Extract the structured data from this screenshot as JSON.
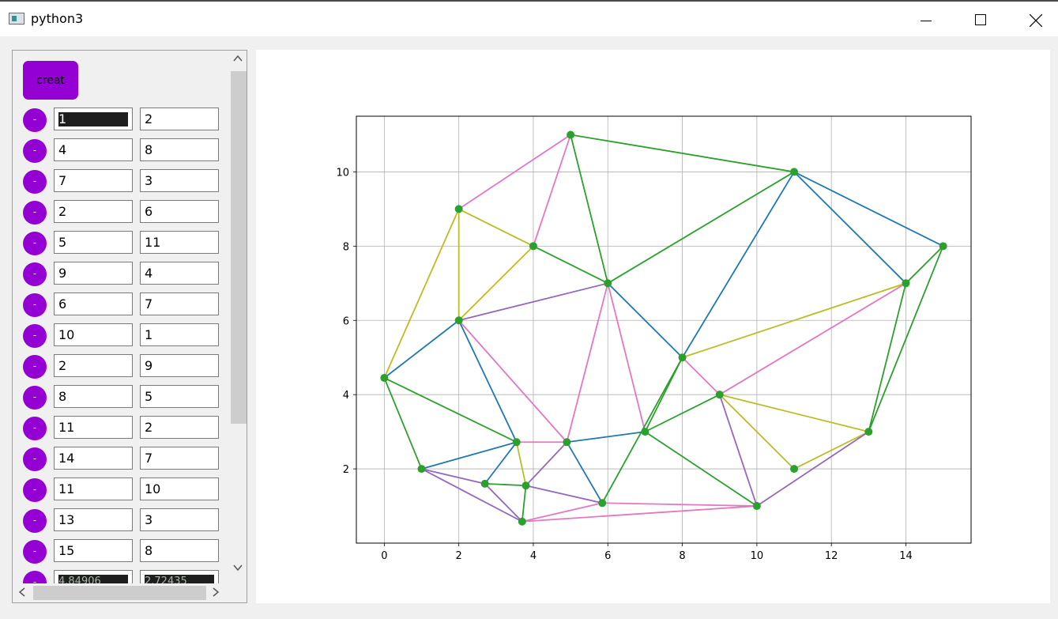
{
  "window": {
    "title": "python3"
  },
  "panel": {
    "create_label": "creat",
    "remove_label": "-",
    "rows": [
      {
        "a": "1",
        "b": "2"
      },
      {
        "a": "4",
        "b": "8"
      },
      {
        "a": "7",
        "b": "3"
      },
      {
        "a": "2",
        "b": "6"
      },
      {
        "a": "5",
        "b": "11"
      },
      {
        "a": "9",
        "b": "4"
      },
      {
        "a": "6",
        "b": "7"
      },
      {
        "a": "10",
        "b": "1"
      },
      {
        "a": "2",
        "b": "9"
      },
      {
        "a": "8",
        "b": "5"
      },
      {
        "a": "11",
        "b": "2"
      },
      {
        "a": "14",
        "b": "7"
      },
      {
        "a": "11",
        "b": "10"
      },
      {
        "a": "13",
        "b": "3"
      },
      {
        "a": "15",
        "b": "8"
      },
      {
        "a": "4.84906",
        "b": "2.72435"
      }
    ]
  },
  "chart_data": {
    "type": "scatter",
    "xlim": [
      -0.75,
      15.75
    ],
    "ylim": [
      0,
      11.5
    ],
    "xticks": [
      0,
      2,
      4,
      6,
      8,
      10,
      12,
      14
    ],
    "yticks": [
      2,
      4,
      6,
      8,
      10
    ],
    "grid": true,
    "point_color": "#2ca02c",
    "points": [
      [
        0,
        4.45
      ],
      [
        1,
        2
      ],
      [
        2,
        9
      ],
      [
        2,
        6
      ],
      [
        2.7,
        1.6
      ],
      [
        3.55,
        2.72
      ],
      [
        3.8,
        1.55
      ],
      [
        3.7,
        0.58
      ],
      [
        4,
        8
      ],
      [
        4.9,
        2.72
      ],
      [
        5,
        11
      ],
      [
        5.85,
        1.08
      ],
      [
        6,
        7
      ],
      [
        7,
        3
      ],
      [
        8,
        5
      ],
      [
        9,
        4
      ],
      [
        10,
        1
      ],
      [
        11,
        2
      ],
      [
        11,
        10
      ],
      [
        13,
        3
      ],
      [
        14,
        7
      ],
      [
        15,
        8
      ]
    ],
    "edges": [
      {
        "p": [
          [
            2,
            9
          ],
          [
            5,
            11
          ]
        ],
        "c": "#e377c2"
      },
      {
        "p": [
          [
            5,
            11
          ],
          [
            11,
            10
          ]
        ],
        "c": "#2ca02c"
      },
      {
        "p": [
          [
            11,
            10
          ],
          [
            15,
            8
          ]
        ],
        "c": "#1f77b4"
      },
      {
        "p": [
          [
            11,
            10
          ],
          [
            14,
            7
          ]
        ],
        "c": "#1f77b4"
      },
      {
        "p": [
          [
            15,
            8
          ],
          [
            14,
            7
          ]
        ],
        "c": "#2ca02c"
      },
      {
        "p": [
          [
            15,
            8
          ],
          [
            13,
            3
          ]
        ],
        "c": "#2ca02c"
      },
      {
        "p": [
          [
            14,
            7
          ],
          [
            13,
            3
          ]
        ],
        "c": "#2ca02c"
      },
      {
        "p": [
          [
            14,
            7
          ],
          [
            8,
            5
          ]
        ],
        "c": "#bcbd22"
      },
      {
        "p": [
          [
            14,
            7
          ],
          [
            9,
            4
          ]
        ],
        "c": "#e377c2"
      },
      {
        "p": [
          [
            11,
            10
          ],
          [
            6,
            7
          ]
        ],
        "c": "#2ca02c"
      },
      {
        "p": [
          [
            11,
            10
          ],
          [
            8,
            5
          ]
        ],
        "c": "#1f77b4"
      },
      {
        "p": [
          [
            5,
            11
          ],
          [
            4,
            8
          ]
        ],
        "c": "#e377c2"
      },
      {
        "p": [
          [
            5,
            11
          ],
          [
            6,
            7
          ]
        ],
        "c": "#2ca02c"
      },
      {
        "p": [
          [
            2,
            9
          ],
          [
            4,
            8
          ]
        ],
        "c": "#bcbd22"
      },
      {
        "p": [
          [
            2,
            9
          ],
          [
            2,
            6
          ]
        ],
        "c": "#bcbd22"
      },
      {
        "p": [
          [
            2,
            9
          ],
          [
            0,
            4.45
          ]
        ],
        "c": "#bcbd22"
      },
      {
        "p": [
          [
            4,
            8
          ],
          [
            2,
            6
          ]
        ],
        "c": "#bcbd22"
      },
      {
        "p": [
          [
            4,
            8
          ],
          [
            6,
            7
          ]
        ],
        "c": "#2ca02c"
      },
      {
        "p": [
          [
            2,
            6
          ],
          [
            6,
            7
          ]
        ],
        "c": "#9467bd"
      },
      {
        "p": [
          [
            0,
            4.45
          ],
          [
            2,
            6
          ]
        ],
        "c": "#1f77b4"
      },
      {
        "p": [
          [
            0,
            4.45
          ],
          [
            3.55,
            2.72
          ]
        ],
        "c": "#2ca02c"
      },
      {
        "p": [
          [
            0,
            4.45
          ],
          [
            1,
            2
          ]
        ],
        "c": "#2ca02c"
      },
      {
        "p": [
          [
            2,
            6
          ],
          [
            3.55,
            2.72
          ]
        ],
        "c": "#1f77b4"
      },
      {
        "p": [
          [
            2,
            6
          ],
          [
            4.9,
            2.72
          ]
        ],
        "c": "#e377c2"
      },
      {
        "p": [
          [
            6,
            7
          ],
          [
            4.9,
            2.72
          ]
        ],
        "c": "#e377c2"
      },
      {
        "p": [
          [
            6,
            7
          ],
          [
            7,
            3
          ]
        ],
        "c": "#e377c2"
      },
      {
        "p": [
          [
            6,
            7
          ],
          [
            8,
            5
          ]
        ],
        "c": "#1f77b4"
      },
      {
        "p": [
          [
            8,
            5
          ],
          [
            9,
            4
          ]
        ],
        "c": "#e377c2"
      },
      {
        "p": [
          [
            8,
            5
          ],
          [
            7,
            3
          ]
        ],
        "c": "#2ca02c"
      },
      {
        "p": [
          [
            8,
            5
          ],
          [
            5.85,
            1.08
          ]
        ],
        "c": "#2ca02c"
      },
      {
        "p": [
          [
            9,
            4
          ],
          [
            7,
            3
          ]
        ],
        "c": "#2ca02c"
      },
      {
        "p": [
          [
            9,
            4
          ],
          [
            13,
            3
          ]
        ],
        "c": "#bcbd22"
      },
      {
        "p": [
          [
            9,
            4
          ],
          [
            11,
            2
          ]
        ],
        "c": "#bcbd22"
      },
      {
        "p": [
          [
            9,
            4
          ],
          [
            10,
            1
          ]
        ],
        "c": "#9467bd"
      },
      {
        "p": [
          [
            13,
            3
          ],
          [
            11,
            2
          ]
        ],
        "c": "#bcbd22"
      },
      {
        "p": [
          [
            13,
            3
          ],
          [
            10,
            1
          ]
        ],
        "c": "#9467bd"
      },
      {
        "p": [
          [
            7,
            3
          ],
          [
            10,
            1
          ]
        ],
        "c": "#2ca02c"
      },
      {
        "p": [
          [
            7,
            3
          ],
          [
            4.9,
            2.72
          ]
        ],
        "c": "#1f77b4"
      },
      {
        "p": [
          [
            4.9,
            2.72
          ],
          [
            3.55,
            2.72
          ]
        ],
        "c": "#e377c2"
      },
      {
        "p": [
          [
            4.9,
            2.72
          ],
          [
            5.85,
            1.08
          ]
        ],
        "c": "#1f77b4"
      },
      {
        "p": [
          [
            4.9,
            2.72
          ],
          [
            3.8,
            1.55
          ]
        ],
        "c": "#9467bd"
      },
      {
        "p": [
          [
            3.55,
            2.72
          ],
          [
            1,
            2
          ]
        ],
        "c": "#1f77b4"
      },
      {
        "p": [
          [
            3.55,
            2.72
          ],
          [
            2.7,
            1.6
          ]
        ],
        "c": "#1f77b4"
      },
      {
        "p": [
          [
            3.55,
            2.72
          ],
          [
            3.8,
            1.55
          ]
        ],
        "c": "#bcbd22"
      },
      {
        "p": [
          [
            1,
            2
          ],
          [
            2.7,
            1.6
          ]
        ],
        "c": "#9467bd"
      },
      {
        "p": [
          [
            1,
            2
          ],
          [
            3.7,
            0.58
          ]
        ],
        "c": "#9467bd"
      },
      {
        "p": [
          [
            2.7,
            1.6
          ],
          [
            3.8,
            1.55
          ]
        ],
        "c": "#2ca02c"
      },
      {
        "p": [
          [
            2.7,
            1.6
          ],
          [
            3.7,
            0.58
          ]
        ],
        "c": "#9467bd"
      },
      {
        "p": [
          [
            3.8,
            1.55
          ],
          [
            3.7,
            0.58
          ]
        ],
        "c": "#2ca02c"
      },
      {
        "p": [
          [
            3.8,
            1.55
          ],
          [
            5.85,
            1.08
          ]
        ],
        "c": "#9467bd"
      },
      {
        "p": [
          [
            3.7,
            0.58
          ],
          [
            5.85,
            1.08
          ]
        ],
        "c": "#e377c2"
      },
      {
        "p": [
          [
            3.7,
            0.58
          ],
          [
            10,
            1
          ]
        ],
        "c": "#e377c2"
      },
      {
        "p": [
          [
            5.85,
            1.08
          ],
          [
            10,
            1
          ]
        ],
        "c": "#e377c2"
      }
    ]
  }
}
